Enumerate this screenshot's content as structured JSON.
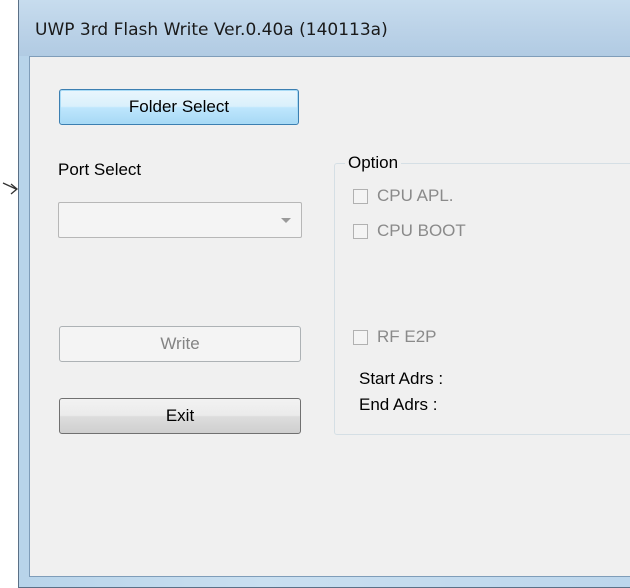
{
  "window": {
    "title": "UWP 3rd Flash Write Ver.0.40a (140113a)"
  },
  "buttons": {
    "folder_select": "Folder Select",
    "write": "Write",
    "exit": "Exit"
  },
  "port": {
    "label": "Port Select",
    "selected": ""
  },
  "option": {
    "title": "Option",
    "cpu_apl": {
      "label": "CPU APL.",
      "checked": false,
      "enabled": false
    },
    "cpu_boot": {
      "label": "CPU BOOT",
      "checked": false,
      "enabled": false
    },
    "rf_e2p": {
      "label": "RF E2P",
      "checked": false,
      "enabled": false
    },
    "start_adrs": "Start Adrs :",
    "end_adrs": "End Adrs :"
  },
  "colors": {
    "title_bar": "#bcd3e8",
    "client_bg": "#f0f0f0",
    "focused_button": "#bee6fd"
  },
  "icons": {
    "pointer": "arrow-pointer-icon"
  }
}
